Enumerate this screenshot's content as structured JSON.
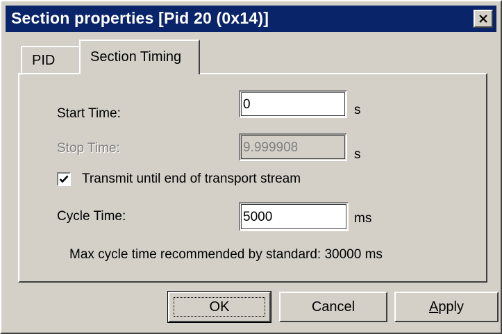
{
  "window": {
    "title": "Section properties [Pid 20 (0x14)]",
    "close_icon": "close-icon"
  },
  "tabs": [
    {
      "label": "PID",
      "active": false
    },
    {
      "label": "Section Timing",
      "active": true
    }
  ],
  "fields": {
    "start_time": {
      "label": "Start Time:",
      "value": "0",
      "unit": "s"
    },
    "stop_time": {
      "label": "Stop Time:",
      "value": "9.999908",
      "unit": "s",
      "disabled": true
    },
    "cycle_time": {
      "label": "Cycle Time:",
      "value": "5000",
      "unit": "ms"
    }
  },
  "transmit_checkbox": {
    "label": "Transmit until end of transport stream",
    "checked": true
  },
  "info_text": "Max cycle time recommended by standard: 30000 ms",
  "buttons": {
    "ok": "OK",
    "cancel": "Cancel",
    "apply_mnemonic": "A",
    "apply_rest": "pply"
  }
}
